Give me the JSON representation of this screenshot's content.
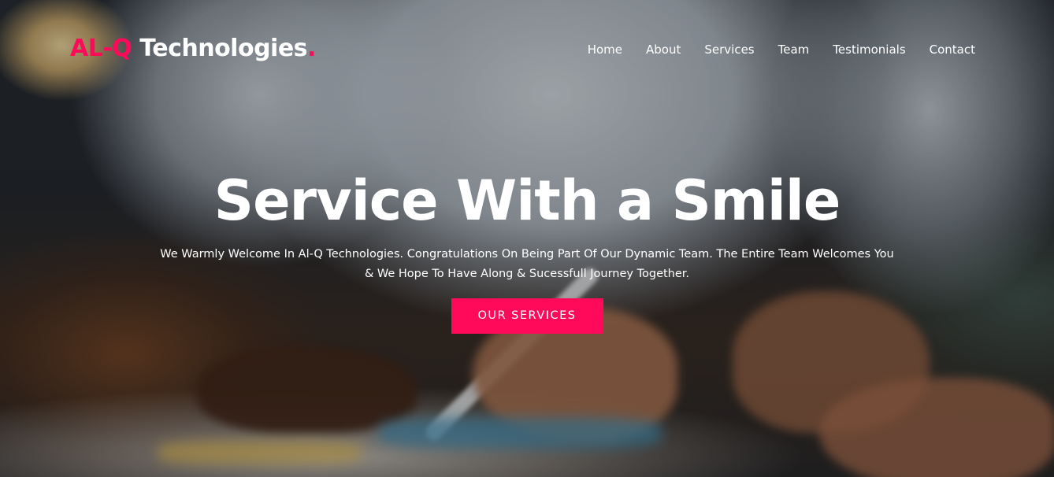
{
  "brand": {
    "accent_part": "AL-Q",
    "main_part": " Technologies",
    "dot": ".",
    "accent_color": "#ff0a5a"
  },
  "nav": {
    "items": [
      "Home",
      "About",
      "Services",
      "Team",
      "Testimonials",
      "Contact"
    ]
  },
  "hero": {
    "headline": "Service With a Smile",
    "subtitle": "We Warmly Welcome In Al-Q Technologies. Congratulations On Being Part Of Our Dynamic Team. The Entire Team Welcomes You & We Hope To Have Along & Sucessfull Journey Together.",
    "cta_label": "OUR SERVICES",
    "cta_color": "#ff0a5a"
  }
}
